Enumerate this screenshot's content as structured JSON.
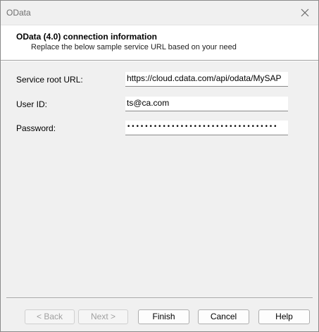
{
  "window": {
    "title": "OData",
    "close_icon": "close-icon"
  },
  "header": {
    "title": "OData (4.0) connection information",
    "subtitle": "Replace the below sample service URL based on your need"
  },
  "form": {
    "service_root_url": {
      "label": "Service root URL:",
      "value": "https://cloud.cdata.com/api/odata/MySAP"
    },
    "user_id": {
      "label": "User ID:",
      "value": "ts@ca.com"
    },
    "password": {
      "label": "Password:",
      "value": "••••••••••••••••••••••••••••••••••"
    }
  },
  "buttons": {
    "back": "< Back",
    "next": "Next >",
    "finish": "Finish",
    "cancel": "Cancel",
    "help": "Help"
  }
}
